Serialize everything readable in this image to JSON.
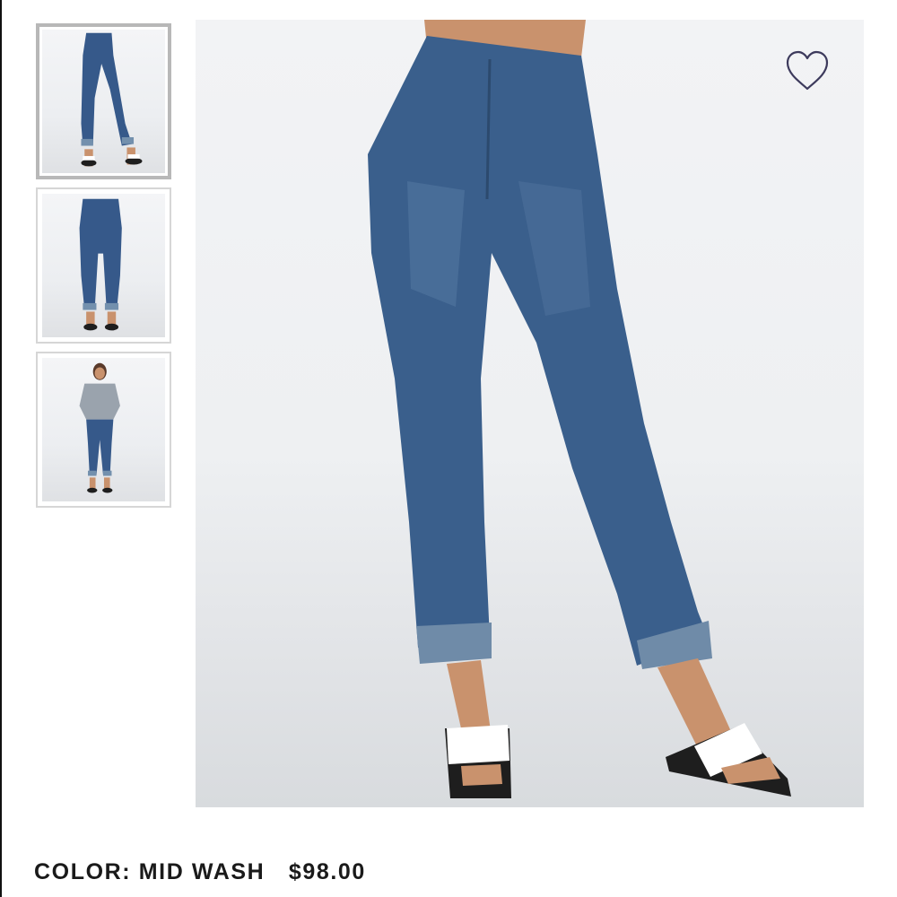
{
  "product": {
    "color_label": "COLOR: MID WASH",
    "price": "$98.00"
  },
  "gallery": {
    "thumbnails": [
      {
        "name": "front-view",
        "active": true
      },
      {
        "name": "back-view",
        "active": false
      },
      {
        "name": "full-outfit-view",
        "active": false
      }
    ],
    "wishlist_icon": "heart-outline-icon"
  },
  "colors": {
    "denim": "#3a5f8c",
    "denim_dark": "#2c4a6e",
    "cuff": "#6f8ba8",
    "skin": "#c9926d",
    "sandal_strap": "#ffffff",
    "sole": "#1e1e1e"
  }
}
